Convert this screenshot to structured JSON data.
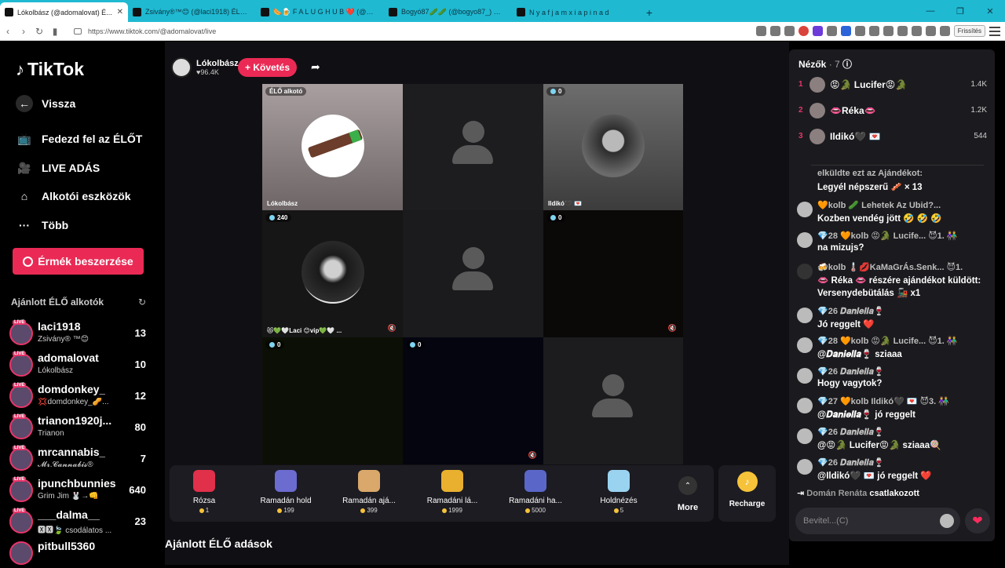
{
  "browser": {
    "tabs": [
      {
        "title": "Lókolbász (@adomalovat) É...",
        "active": true
      },
      {
        "title": "Zsivány®™😊 (@laci1918) ÉLŐ adás",
        "active": false
      },
      {
        "title": "🌭🍺 F A L U G H U B ❤️ (@gabor",
        "active": false
      },
      {
        "title": "Bogyó87🥒🥒 (@bogyo87_) ÉLŐ",
        "active": false
      },
      {
        "title": "N y a f j a m x i a p i n a d",
        "active": false
      }
    ],
    "newtab": "+",
    "url": "https://www.tiktok.com/@adomalovat/live",
    "refresh_label": "Frissítés"
  },
  "sidebar": {
    "logo": "TikTok",
    "back": "Vissza",
    "nav": [
      {
        "label": "Fedezd fel az ÉLŐT",
        "icon": "tv-icon"
      },
      {
        "label": "LIVE ADÁS",
        "icon": "camera-icon"
      },
      {
        "label": "Alkotói eszközök",
        "icon": "home-icon"
      },
      {
        "label": "Több",
        "icon": "more-icon"
      }
    ],
    "coins_button": "Érmék beszerzése",
    "recommended_title": "Ajánlott ÉLŐ alkotók",
    "live_badge": "LIVE",
    "recommended": [
      {
        "name": "laci1918",
        "sub": "Zsivány® ™😊",
        "count": "13"
      },
      {
        "name": "adomalovat",
        "sub": "Lókolbász",
        "count": "10"
      },
      {
        "name": "domdonkey_",
        "sub": "💢domdonkey_🥜...",
        "count": "12"
      },
      {
        "name": "trianon1920j...",
        "sub": "Trianon",
        "count": "80"
      },
      {
        "name": "mrcannabis_",
        "sub": "𝓜𝓻.𝓒𝓪𝓷𝓷𝓪𝓫𝓲𝓼®",
        "count": "7"
      },
      {
        "name": "ipunchbunnies",
        "sub": "Grim Jim 🐰→👊",
        "count": "640"
      },
      {
        "name": "___dalma__",
        "sub": "🆇🆇🍃 csodálatos ...",
        "count": "23"
      },
      {
        "name": "pitbull5360",
        "sub": "",
        "count": ""
      }
    ]
  },
  "main": {
    "host_name": "Lókolbász",
    "host_likes": "♥96.4K",
    "follow": "+ Követés",
    "grid": [
      {
        "badge": "ÉLŐ alkotó",
        "name": "Lókolbász"
      },
      {
        "badge": "",
        "name": ""
      },
      {
        "badge": "0",
        "name": "Ildikó🖤 💌"
      },
      {
        "badge": "240",
        "name": "😻💚🤍Laci 😊vip💚🤍 ..."
      },
      {
        "badge": "",
        "name": ""
      },
      {
        "badge": "0",
        "name": ""
      },
      {
        "badge": "0",
        "name": ""
      },
      {
        "badge": "0",
        "name": ""
      },
      {
        "badge": "",
        "name": ""
      }
    ],
    "gifts": [
      {
        "name": "Rózsa",
        "price": "1",
        "color": "#e0304a"
      },
      {
        "name": "Ramadán hold",
        "price": "199",
        "color": "#6b6bd0"
      },
      {
        "name": "Ramadán ajá...",
        "price": "399",
        "color": "#d9a86a"
      },
      {
        "name": "Ramadáni lá...",
        "price": "1999",
        "color": "#e9b030"
      },
      {
        "name": "Ramadáni ha...",
        "price": "5000",
        "color": "#5a67c8"
      },
      {
        "name": "Holdnézés",
        "price": "5",
        "color": "#9ad3f0"
      }
    ],
    "more": "More",
    "recharge": "Recharge",
    "recommended_live": "Ajánlott ÉLŐ adások"
  },
  "viewers": {
    "title": "Nézők",
    "count": "· 7",
    "list": [
      {
        "rank": "1",
        "name": "😡🐊 Lucifer😡🐊",
        "score": "1.4K"
      },
      {
        "rank": "2",
        "name": "👄Réka👄",
        "score": "1.2K"
      },
      {
        "rank": "3",
        "name": "Ildikó🖤 💌",
        "score": "544"
      }
    ]
  },
  "chat": [
    {
      "head": "elküldte ezt az Ajándékot:",
      "text": "Legyél népszerű 🥓 × 13"
    },
    {
      "head": "🧡kolb 🥒 Lehetek Az Ubid?...",
      "text": "Kozben vendég jött 🤣 🤣 🤣"
    },
    {
      "head": "💎28 🧡kolb 😡🐊 Lucife... 😈1. 👫",
      "text": "na mizujs?"
    },
    {
      "head": "🍻kolb 🌡️💋KaMaGrÁs.Senk... 😈1.",
      "text": "👄 Réka 👄 részére ajándékot küldött:",
      "text2": "Versenydebütálás 🚂 x1"
    },
    {
      "head": "💎26 𝑫𝒂𝒏𝒊𝒆𝒍𝒍𝒂🍷",
      "text": "Jó reggelt ❤️"
    },
    {
      "head": "💎28 🧡kolb 😡🐊 Lucife... 😈1. 👫",
      "text": "@𝑫𝒂𝒏𝒊𝒆𝒍𝒍𝒂🍷 sziaaa"
    },
    {
      "head": "💎26 𝑫𝒂𝒏𝒊𝒆𝒍𝒍𝒂🍷",
      "text": "Hogy vagytok?"
    },
    {
      "head": "💎27 🧡kolb Ildikó🖤 💌 😈3. 👫",
      "text": "@𝑫𝒂𝒏𝒊𝒆𝒍𝒍𝒂🍷 jó reggelt"
    },
    {
      "head": "💎26 𝑫𝒂𝒏𝒊𝒆𝒍𝒍𝒂🍷",
      "text": "@😡🐊 Lucifer😡🐊 sziaaa🍭"
    },
    {
      "head": "💎26 𝑫𝒂𝒏𝒊𝒆𝒍𝒍𝒂🍷",
      "text": "@Ildikó🖤 💌 jó reggelt ❤️"
    }
  ],
  "join": {
    "name": "Domán Renáta",
    "action": "csatlakozott"
  },
  "input_placeholder": "Bevitel...(C)"
}
